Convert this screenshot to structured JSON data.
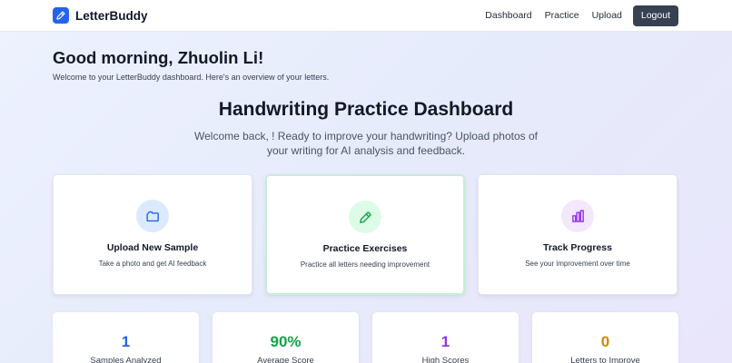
{
  "app": {
    "name": "LetterBuddy"
  },
  "nav": {
    "links": [
      "Dashboard",
      "Practice",
      "Upload"
    ],
    "logout_label": "Logout"
  },
  "greeting": {
    "title": "Good morning, Zhuolin Li!",
    "subtitle": "Welcome to your LetterBuddy dashboard. Here's an overview of your letters."
  },
  "dashboard": {
    "title": "Handwriting Practice Dashboard",
    "subtitle": "Welcome back, ! Ready to improve your handwriting? Upload photos of your writing for AI analysis and feedback."
  },
  "actions": [
    {
      "title": "Upload New Sample",
      "description": "Take a photo and get AI feedback",
      "icon": "upload-icon",
      "color": "#2563eb",
      "bg": "#dbeafe"
    },
    {
      "title": "Practice Exercises",
      "description": "Practice all letters needing improvement",
      "icon": "pencil-icon",
      "color": "#16a34a",
      "bg": "#dcfce7"
    },
    {
      "title": "Track Progress",
      "description": "See your improvement over time",
      "icon": "bar-chart-icon",
      "color": "#9333ea",
      "bg": "#f3e8ff"
    }
  ],
  "stats": [
    {
      "value": "1",
      "label": "Samples Analyzed",
      "color": "#2563eb"
    },
    {
      "value": "90%",
      "label": "Average Score",
      "color": "#16a34a"
    },
    {
      "value": "1",
      "label": "High Scores",
      "color": "#9333ea"
    },
    {
      "value": "0",
      "label": "Letters to Improve",
      "color": "#ca8a04"
    }
  ]
}
